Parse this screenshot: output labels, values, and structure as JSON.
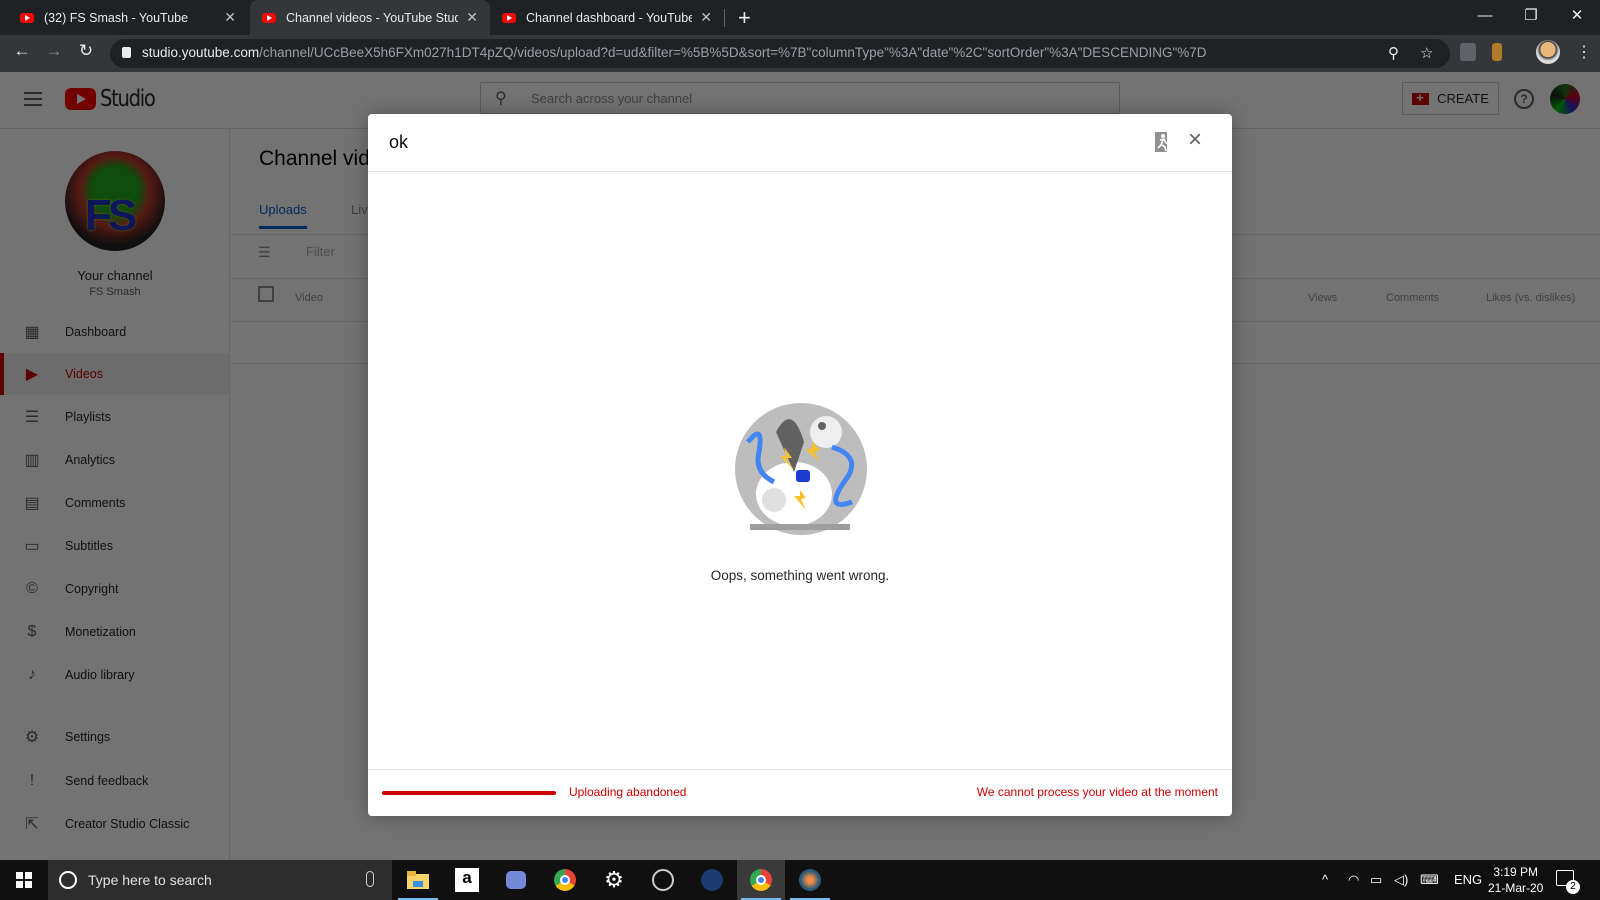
{
  "browser": {
    "tabs": [
      {
        "label": "(32) FS Smash - YouTube",
        "active": false
      },
      {
        "label": "Channel videos - YouTube Studio",
        "active": true
      },
      {
        "label": "Channel dashboard - YouTube Studio",
        "active": false
      }
    ],
    "new_tab": "+",
    "url_host": "studio.youtube.com",
    "url_path": "/channel/UCcBeeX5h6FXm027h1DT4pZQ/videos/upload?d=ud&filter=%5B%5D&sort=%7B\"columnType\"%3A\"date\"%2C\"sortOrder\"%3A\"DESCENDING\"%7D",
    "nav": {
      "back": "←",
      "forward": "→",
      "reload": "↻"
    },
    "window_controls": {
      "minimize": "—",
      "restore": "❐",
      "close": "✕"
    },
    "icons": {
      "zoom": "zoom-icon",
      "bookmark": "star-icon",
      "menu": "⋮"
    }
  },
  "studio": {
    "header": {
      "logo_text": "Studio",
      "search_placeholder": "Search across your channel",
      "create_label": "CREATE",
      "help": "?"
    },
    "sidebar": {
      "channel_title": "Your channel",
      "channel_name": "FS Smash",
      "avatar_text": "FS",
      "items": [
        {
          "label": "Dashboard",
          "icon": "▦",
          "active": false
        },
        {
          "label": "Videos",
          "icon": "▶",
          "active": true
        },
        {
          "label": "Playlists",
          "icon": "☰",
          "active": false
        },
        {
          "label": "Analytics",
          "icon": "▥",
          "active": false
        },
        {
          "label": "Comments",
          "icon": "▤",
          "active": false
        },
        {
          "label": "Subtitles",
          "icon": "▭",
          "active": false
        },
        {
          "label": "Copyright",
          "icon": "©",
          "active": false
        },
        {
          "label": "Monetization",
          "icon": "$",
          "active": false
        },
        {
          "label": "Audio library",
          "icon": "♪",
          "active": false
        },
        {
          "label": "Settings",
          "icon": "⚙",
          "active": false
        },
        {
          "label": "Send feedback",
          "icon": "!",
          "active": false
        },
        {
          "label": "Creator Studio Classic",
          "icon": "⇱",
          "active": false
        }
      ]
    },
    "main": {
      "title": "Channel videos",
      "tabs": [
        {
          "label": "Uploads",
          "active": true
        },
        {
          "label": "Live",
          "active": false
        }
      ],
      "filter_placeholder": "Filter",
      "columns": [
        "Video",
        "Views",
        "Comments",
        "Likes (vs. dislikes)"
      ]
    }
  },
  "dialog": {
    "title": "ok",
    "error_message": "Oops, something went wrong.",
    "progress_percent": 100,
    "status_left": "Uploading abandoned",
    "status_right": "We cannot process your video at the moment",
    "close": "×"
  },
  "taskbar": {
    "search_placeholder": "Type here to search",
    "apps": [
      "file-explorer",
      "amazon",
      "discord",
      "chrome",
      "settings",
      "obs",
      "steam",
      "chrome-active",
      "davinci-resolve"
    ],
    "language": "ENG",
    "time": "3:19 PM",
    "date": "21-Mar-20",
    "notifications_count": "2"
  },
  "colors": {
    "accent": "#cc0000",
    "link": "#065fd4"
  }
}
